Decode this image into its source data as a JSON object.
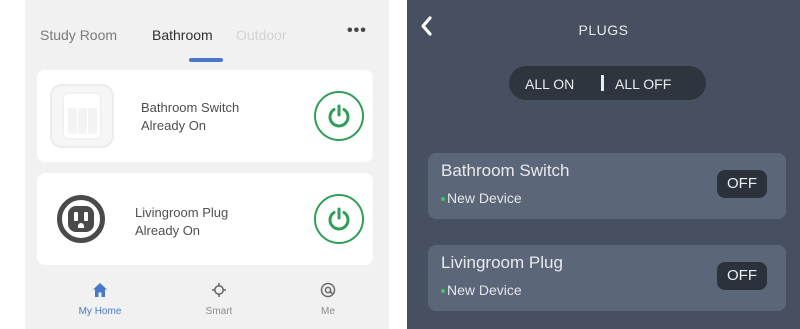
{
  "left": {
    "tabs": [
      {
        "label": "Study Room"
      },
      {
        "label": "Bathroom"
      },
      {
        "label": "Outdoor"
      }
    ],
    "more_label": "•••",
    "devices": [
      {
        "name": "Bathroom Switch",
        "status": "Already On",
        "icon": "wall-switch-icon"
      },
      {
        "name": "Livingroom Plug",
        "status": "Already On",
        "icon": "plug-icon"
      }
    ],
    "nav": [
      {
        "label": "My Home",
        "icon": "home-icon"
      },
      {
        "label": "Smart",
        "icon": "smart-icon"
      },
      {
        "label": "Me",
        "icon": "me-icon"
      }
    ],
    "colors": {
      "accent": "#4a78c8",
      "power": "#2f9e57",
      "background": "#f1f1f1"
    }
  },
  "right": {
    "title": "PLUGS",
    "all_on": "ALL ON",
    "all_off": "ALL OFF",
    "devices": [
      {
        "name": "Bathroom Switch",
        "sub": "New Device",
        "state": "OFF"
      },
      {
        "name": "Livingroom Plug",
        "sub": "New Device",
        "state": "OFF"
      }
    ],
    "colors": {
      "background": "#465060",
      "row": "#5b6678",
      "dot": "#3ec764"
    }
  }
}
